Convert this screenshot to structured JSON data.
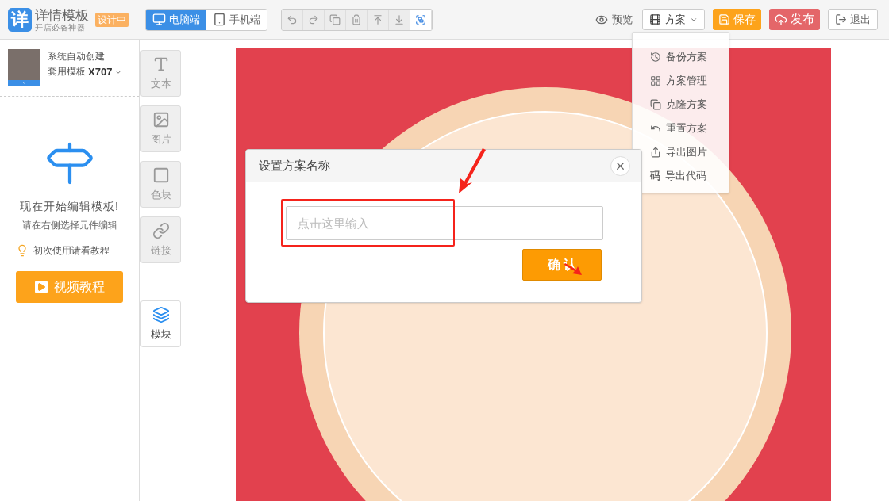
{
  "app": {
    "logo_char": "详",
    "name": "详情模板",
    "tagline": "开店必备神器",
    "status_badge": "设计中"
  },
  "view_tabs": [
    {
      "kind": "desktop",
      "label": "电脑端",
      "selected": true
    },
    {
      "kind": "mobile",
      "label": "手机端",
      "selected": false
    }
  ],
  "toolbar_tools": [
    {
      "kind": "undo",
      "selected": false
    },
    {
      "kind": "redo",
      "selected": false
    },
    {
      "kind": "duplicate",
      "selected": false
    },
    {
      "kind": "delete",
      "selected": false
    },
    {
      "kind": "move_top",
      "selected": false
    },
    {
      "kind": "move_bottom",
      "selected": false
    },
    {
      "kind": "group",
      "selected": true
    }
  ],
  "header_actions": {
    "preview": "预览",
    "plan_menu": {
      "label": "方案",
      "expanded": true
    },
    "save": "保存",
    "publish": "发布",
    "exit": "退出"
  },
  "plan_menu_items": [
    {
      "kind": "history",
      "label": "备份方案"
    },
    {
      "kind": "manage",
      "label": "方案管理"
    },
    {
      "kind": "clone",
      "label": "克隆方案"
    },
    {
      "kind": "reset",
      "label": "重置方案"
    },
    {
      "kind": "export_image",
      "label": "导出图片"
    },
    {
      "kind": "export_code",
      "icon_text": "码",
      "label": "导出代码"
    }
  ],
  "template": {
    "line1": "系统自动创建",
    "prefix": "套用模板",
    "code": "X707"
  },
  "sidebar": {
    "headline": "现在开始编辑模板!",
    "subline": "请在右侧选择元件编辑",
    "tip": "初次使用请看教程",
    "video_button": "视频教程"
  },
  "tools": [
    {
      "kind": "text",
      "label": "文本"
    },
    {
      "kind": "image",
      "label": "图片"
    },
    {
      "kind": "color_block",
      "label": "色块"
    },
    {
      "kind": "link",
      "label": "链接"
    }
  ],
  "module_button": {
    "label": "模块",
    "selected": true
  },
  "dialog": {
    "title": "设置方案名称",
    "placeholder": "点击这里输入",
    "confirm": "确 认"
  }
}
